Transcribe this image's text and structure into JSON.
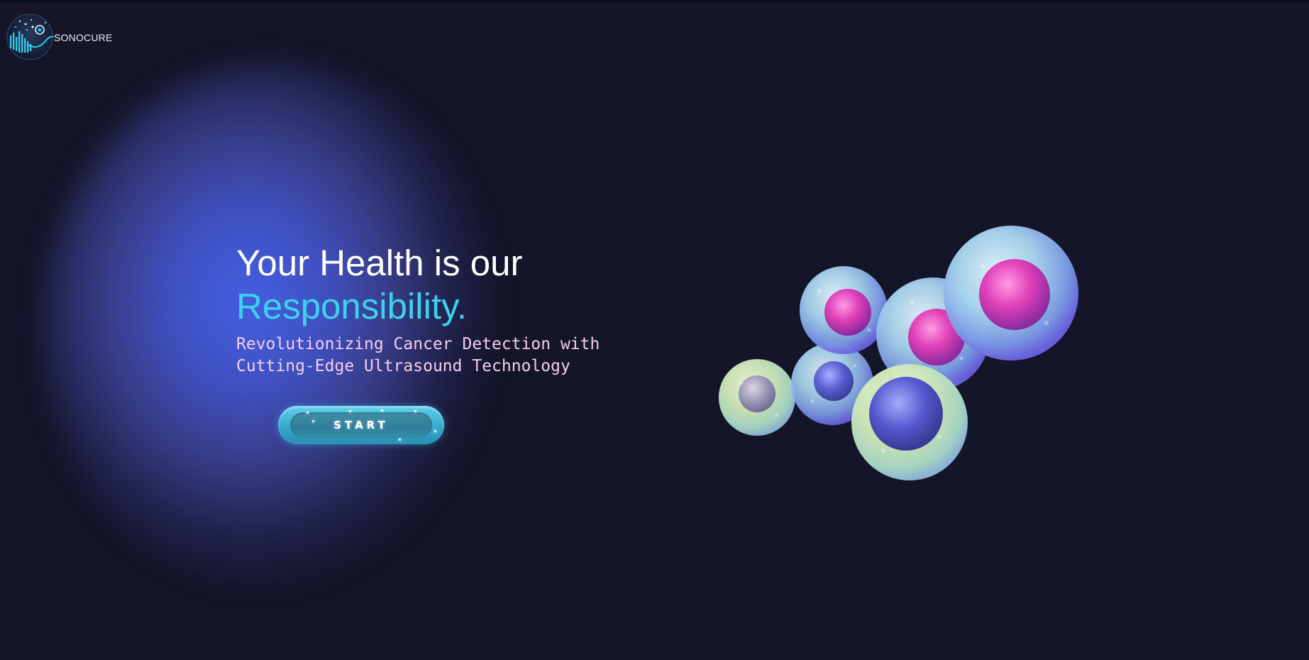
{
  "brand": {
    "name": "SONOCURE",
    "logo_icon": "sonocure-logo-icon"
  },
  "hero": {
    "headline_line1": "Your Health is our",
    "headline_line2": "Responsibility.",
    "subheadline": "Revolutionizing Cancer Detection with\nCutting-Edge Ultrasound Technology",
    "cta_label": "START"
  },
  "illustration": {
    "icon": "cancer-cells-illustration"
  },
  "colors": {
    "background": "#141529",
    "accent": "#3cd2ee",
    "subtitle": "#f5cdee",
    "glow": "#4664eb",
    "button": "#36a8cc"
  }
}
